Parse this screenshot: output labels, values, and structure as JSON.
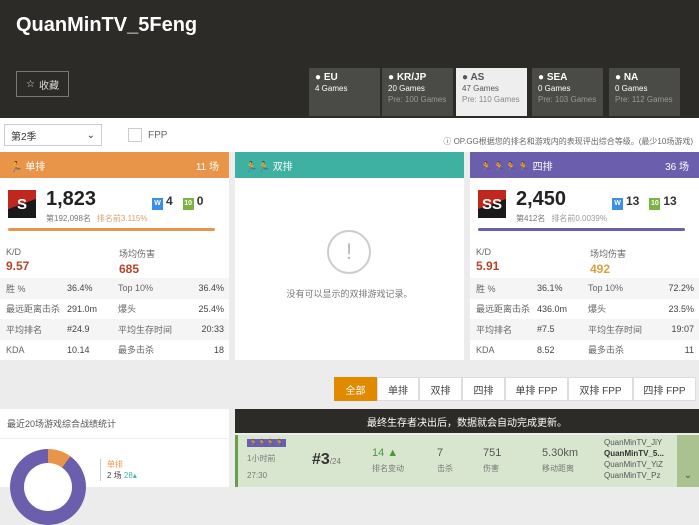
{
  "player": "QuanMinTV_5Feng",
  "favorite_label": "收藏",
  "regions": [
    {
      "name": "EU",
      "games": "4 Games",
      "pre": ""
    },
    {
      "name": "KR/JP",
      "games": "20 Games",
      "pre": "Pre: 100 Games"
    },
    {
      "name": "AS",
      "games": "47 Games",
      "pre": "Pre: 110 Games"
    },
    {
      "name": "SEA",
      "games": "0 Games",
      "pre": "Pre: 103 Games"
    },
    {
      "name": "NA",
      "games": "0 Games",
      "pre": "Pre: 112 Games"
    }
  ],
  "season": "第2季",
  "fpp_label": "FPP",
  "note": "OP.GG根据您的排名和游戏内的表现评出综合等级。(最少10场游戏)",
  "solo": {
    "title": "单排",
    "games": "11 场",
    "tier": "S",
    "rating": "1,823",
    "rank": "第192,098名",
    "pct": "排名前3.115%",
    "wins": "4",
    "top10": "0",
    "kd_label": "K/D",
    "kd": "9.57",
    "dmg_label": "场均伤害",
    "dmg": "685",
    "rows": [
      [
        "胜 %",
        "36.4%",
        "Top 10%",
        "36.4%"
      ],
      [
        "最远距离击杀",
        "291.0m",
        "爆头",
        "25.4%"
      ],
      [
        "平均排名",
        "#24.9",
        "平均生存时间",
        "20:33"
      ],
      [
        "KDA",
        "10.14",
        "最多击杀",
        "18"
      ]
    ]
  },
  "duo": {
    "title": "双排",
    "empty": "没有可以显示的双排游戏记录。"
  },
  "squad": {
    "title": "四排",
    "games": "36 场",
    "tier": "SS",
    "rating": "2,450",
    "rank": "第412名",
    "pct": "排名前0.0039%",
    "wins": "13",
    "top10": "13",
    "kd_label": "K/D",
    "kd": "5.91",
    "dmg_label": "场均伤害",
    "dmg": "492",
    "rows": [
      [
        "胜 %",
        "36.1%",
        "Top 10%",
        "72.2%"
      ],
      [
        "最远距离击杀",
        "436.0m",
        "爆头",
        "23.5%"
      ],
      [
        "平均排名",
        "#7.5",
        "平均生存时间",
        "19:07"
      ],
      [
        "KDA",
        "8.52",
        "最多击杀",
        "11"
      ]
    ]
  },
  "mode_tabs": [
    "全部",
    "单排",
    "双排",
    "四排",
    "单排 FPP",
    "双排 FPP",
    "四排 FPP"
  ],
  "stats_title": "最近20场游戏综合战绩统计",
  "stats_legend": {
    "label": "单排",
    "value": "2 场",
    "rank": "28"
  },
  "banner": "最终生存者决出后，数据就会自动完成更新。",
  "match": {
    "time": "1小时前",
    "duration": "27:30",
    "place": "#3",
    "total": "/24",
    "rank_change": "14",
    "rank_change_label": "排名变动",
    "kills": "7",
    "kills_label": "击杀",
    "damage": "751",
    "damage_label": "伤害",
    "distance": "5.30km",
    "distance_label": "移动距离",
    "team": [
      "QuanMinTV_JiY",
      "QuanMinTV_5...",
      "QuanMinTV_YiZ",
      "QuanMinTV_Pz"
    ]
  },
  "colors": {
    "solo": "#e8954a",
    "duo": "#3fb1a3",
    "squad": "#6b5fad",
    "active_tab": "#e08a00"
  }
}
